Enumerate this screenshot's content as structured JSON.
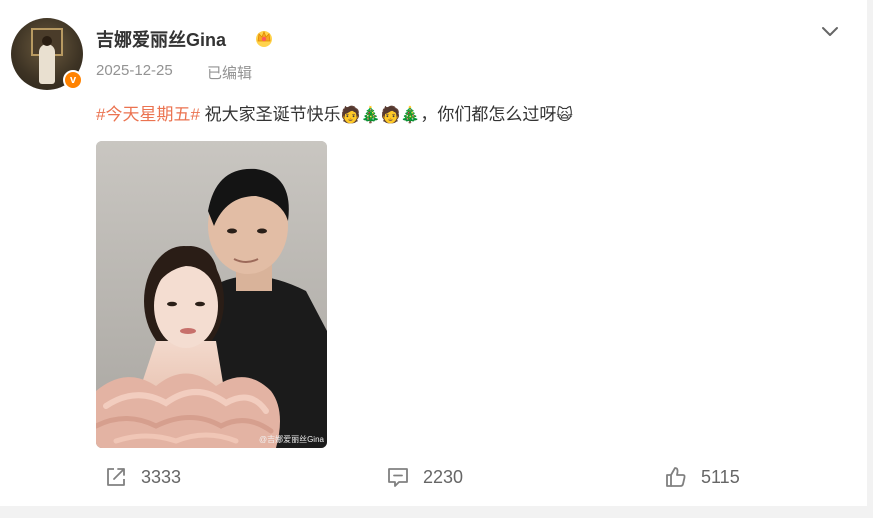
{
  "post": {
    "author": "吉娜爱丽丝Gina",
    "date": "2025-12-25",
    "edited_label": "已编辑",
    "hashtag": "#今天星期五#",
    "text_part1": " 祝大家圣诞节快乐",
    "emoji_seq": "🧑🎄🧑🎄",
    "text_part2": "，你们都怎么过呀",
    "emoji_end": "🙀",
    "image_watermark": "@吉娜爱丽丝Gina"
  },
  "actions": {
    "reposts": "3333",
    "comments": "2230",
    "likes": "5115"
  },
  "colors": {
    "accent": "#eb7350",
    "verified": "#ff8200",
    "muted": "#939393"
  },
  "icons": {
    "badge": "verified-badge-icon",
    "crown": "crown-icon",
    "menu": "chevron-down-icon",
    "repost": "repost-icon",
    "comment": "comment-icon",
    "like": "thumbs-up-icon"
  }
}
